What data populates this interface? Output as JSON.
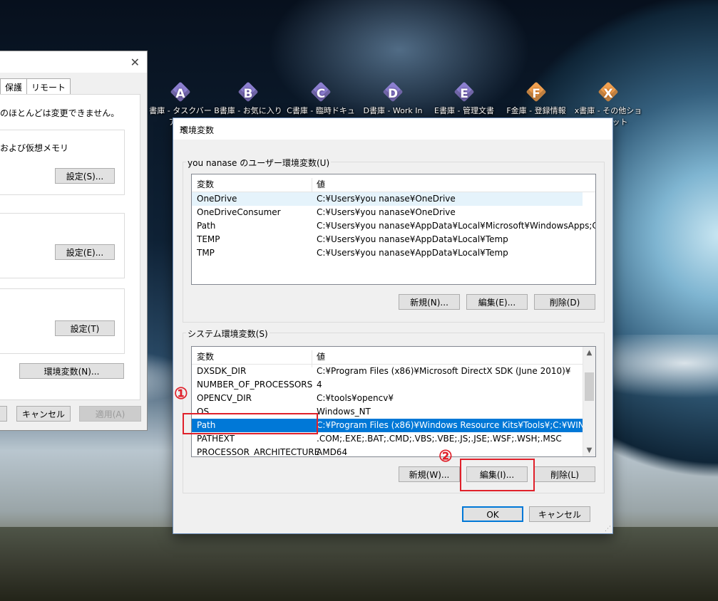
{
  "desktop": {
    "icons": [
      {
        "letter": "A",
        "label": "書庫 - タスクバーアプリ",
        "color": "purple"
      },
      {
        "letter": "B",
        "label": "B書庫 - お気に入り",
        "color": "purple"
      },
      {
        "letter": "C",
        "label": "C書庫 - 臨時ドキュ",
        "color": "purple"
      },
      {
        "letter": "D",
        "label": "D書庫 - Work In",
        "color": "purple"
      },
      {
        "letter": "E",
        "label": "E書庫 - 管理文書",
        "color": "purple"
      },
      {
        "letter": "F",
        "label": "F金庫 - 登録情報",
        "color": "orange"
      },
      {
        "letter": "X",
        "label": "x書庫 - その他ショートカット",
        "color": "orange"
      }
    ]
  },
  "sys_dialog": {
    "close": "✕",
    "tabs": [
      "保護",
      "リモート"
    ],
    "note": "のほとんどは変更できません。",
    "perf_label": "および仮想メモリ",
    "settings_s": "設定(S)...",
    "settings_e": "設定(E)...",
    "settings_t": "設定(T)",
    "env_button": "環境変数(N)...",
    "cancel": "キャンセル",
    "apply": "適用(A)"
  },
  "env_dialog": {
    "title": "環境変数",
    "close": "✕",
    "user_group": "you nanase のユーザー環境変数(U)",
    "col_var": "変数",
    "col_val": "値",
    "user_vars": [
      {
        "name": "OneDrive",
        "value": "C:¥Users¥you nanase¥OneDrive"
      },
      {
        "name": "OneDriveConsumer",
        "value": "C:¥Users¥you nanase¥OneDrive"
      },
      {
        "name": "Path",
        "value": "C:¥Users¥you nanase¥AppData¥Local¥Microsoft¥WindowsApps;C:¥..."
      },
      {
        "name": "TEMP",
        "value": "C:¥Users¥you nanase¥AppData¥Local¥Temp"
      },
      {
        "name": "TMP",
        "value": "C:¥Users¥you nanase¥AppData¥Local¥Temp"
      }
    ],
    "user_new": "新規(N)...",
    "user_edit": "編集(E)...",
    "user_delete": "削除(D)",
    "system_group": "システム環境変数(S)",
    "system_vars": [
      {
        "name": "DXSDK_DIR",
        "value": "C:¥Program Files (x86)¥Microsoft DirectX SDK (June 2010)¥"
      },
      {
        "name": "NUMBER_OF_PROCESSORS",
        "value": "4"
      },
      {
        "name": "OPENCV_DIR",
        "value": "C:¥tools¥opencv¥"
      },
      {
        "name": "OS",
        "value": "Windows_NT"
      },
      {
        "name": "Path",
        "value": "C:¥Program Files (x86)¥Windows Resource Kits¥Tools¥;C:¥WINDOW..."
      },
      {
        "name": "PATHEXT",
        "value": ".COM;.EXE;.BAT;.CMD;.VBS;.VBE;.JS;.JSE;.WSF;.WSH;.MSC"
      },
      {
        "name": "PROCESSOR_ARCHITECTURE",
        "value": "AMD64"
      }
    ],
    "sys_new": "新規(W)...",
    "sys_edit": "編集(I)...",
    "sys_delete": "削除(L)",
    "ok": "OK",
    "cancel": "キャンセル"
  },
  "annotations": {
    "step1": "①",
    "step2": "②"
  },
  "colors": {
    "selection": "#0078d7",
    "annotation": "#e0202a"
  }
}
